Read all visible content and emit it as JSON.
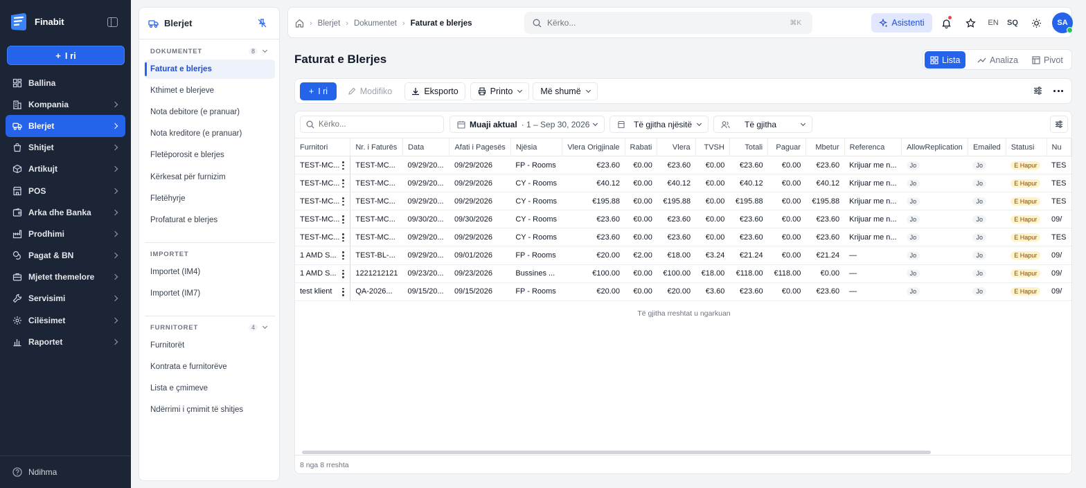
{
  "app": {
    "brand": "Finabit",
    "new_button": "I ri",
    "help": "Ndihma"
  },
  "sidebar": {
    "items": [
      {
        "label": "Ballina",
        "icon": "dashboard-icon",
        "chevron": false
      },
      {
        "label": "Kompania",
        "icon": "building-icon",
        "chevron": true
      },
      {
        "label": "Blerjet",
        "icon": "truck-icon",
        "chevron": true,
        "active": true
      },
      {
        "label": "Shitjet",
        "icon": "shopping-bag-icon",
        "chevron": true
      },
      {
        "label": "Artikujt",
        "icon": "box-icon",
        "chevron": true
      },
      {
        "label": "POS",
        "icon": "store-icon",
        "chevron": true
      },
      {
        "label": "Arka dhe Banka",
        "icon": "wallet-icon",
        "chevron": true
      },
      {
        "label": "Prodhimi",
        "icon": "factory-icon",
        "chevron": true
      },
      {
        "label": "Pagat & BN",
        "icon": "coins-icon",
        "chevron": true
      },
      {
        "label": "Mjetet themelore",
        "icon": "briefcase-icon",
        "chevron": true
      },
      {
        "label": "Servisimi",
        "icon": "wrench-icon",
        "chevron": true
      },
      {
        "label": "Cilësimet",
        "icon": "gear-icon",
        "chevron": true
      },
      {
        "label": "Raportet",
        "icon": "bar-chart-icon",
        "chevron": true
      }
    ]
  },
  "panel": {
    "title": "Blerjet",
    "sections": [
      {
        "title": "DOKUMENTET",
        "count": "8",
        "links": [
          "Faturat e blerjes",
          "Kthimet e blerjeve",
          "Nota debitore (e pranuar)",
          "Nota kreditore (e pranuar)",
          "Fletëporosit e blerjes",
          "Kërkesat për furnizim",
          "Fletëhyrje",
          "Profaturat e blerjes"
        ]
      },
      {
        "title": "IMPORTET",
        "count": "",
        "links": [
          "Importet (IM4)",
          "Importet (IM7)"
        ]
      },
      {
        "title": "FURNITORET",
        "count": "4",
        "links": [
          "Furnitorët",
          "Kontrata e furnitorëve",
          "Lista e çmimeve",
          "Ndërrimi i çmimit të shitjes"
        ]
      }
    ]
  },
  "topbar": {
    "breadcrumb": [
      "Blerjet",
      "Dokumentet",
      "Faturat e blerjes"
    ],
    "search_placeholder": "Kërko...",
    "shortcut": "⌘K",
    "assistant": "Asistenti",
    "lang_en": "EN",
    "lang_sq": "SQ",
    "avatar": "SA"
  },
  "page": {
    "title": "Faturat e Blerjes",
    "views": [
      "Lista",
      "Analiza",
      "Pivot"
    ]
  },
  "toolbar": {
    "new": "I ri",
    "edit": "Modifiko",
    "export": "Eksporto",
    "print": "Printo",
    "more": "Më shumë"
  },
  "filters": {
    "search_placeholder": "Kërko...",
    "period_label": "Muaji aktual",
    "period_range": "· 1 – Sep 30, 2026",
    "unit": "Të gjitha njësitë",
    "party": "Të gjitha"
  },
  "table": {
    "columns": [
      "Furnitori",
      "Nr. i Faturës",
      "Data",
      "Afati i Pagesës",
      "Njësia",
      "Vlera Origjinale",
      "Rabati",
      "Vlera",
      "TVSH",
      "Totali",
      "Paguar",
      "Mbetur",
      "Referenca",
      "AllowReplication",
      "Emailed",
      "Statusi",
      "Nu"
    ],
    "rows": [
      [
        "TEST-MC...",
        "TEST-MC...",
        "09/29/20...",
        "09/29/2026",
        "FP - Rooms",
        "€23.60",
        "€0.00",
        "€23.60",
        "€0.00",
        "€23.60",
        "€0.00",
        "€23.60",
        "Krijuar me n...",
        "Jo",
        "Jo",
        "E Hapur",
        "TES"
      ],
      [
        "TEST-MC...",
        "TEST-MC...",
        "09/29/20...",
        "09/29/2026",
        "CY - Rooms",
        "€40.12",
        "€0.00",
        "€40.12",
        "€0.00",
        "€40.12",
        "€0.00",
        "€40.12",
        "Krijuar me n...",
        "Jo",
        "Jo",
        "E Hapur",
        "TES"
      ],
      [
        "TEST-MC...",
        "TEST-MC...",
        "09/29/20...",
        "09/29/2026",
        "CY - Rooms",
        "€195.88",
        "€0.00",
        "€195.88",
        "€0.00",
        "€195.88",
        "€0.00",
        "€195.88",
        "Krijuar me n...",
        "Jo",
        "Jo",
        "E Hapur",
        "TES"
      ],
      [
        "TEST-MC...",
        "TEST-MC...",
        "09/30/20...",
        "09/30/2026",
        "CY - Rooms",
        "€23.60",
        "€0.00",
        "€23.60",
        "€0.00",
        "€23.60",
        "€0.00",
        "€23.60",
        "Krijuar me n...",
        "Jo",
        "Jo",
        "E Hapur",
        "09/"
      ],
      [
        "TEST-MC...",
        "TEST-MC...",
        "09/29/20...",
        "09/29/2026",
        "CY - Rooms",
        "€23.60",
        "€0.00",
        "€23.60",
        "€0.00",
        "€23.60",
        "€0.00",
        "€23.60",
        "Krijuar me n...",
        "Jo",
        "Jo",
        "E Hapur",
        "TES"
      ],
      [
        "1 AMD S...",
        "TEST-BL-...",
        "09/29/20...",
        "09/01/2026",
        "FP - Rooms",
        "€20.00",
        "€2.00",
        "€18.00",
        "€3.24",
        "€21.24",
        "€0.00",
        "€21.24",
        "—",
        "Jo",
        "Jo",
        "E Hapur",
        "09/"
      ],
      [
        "1 AMD S...",
        "1221212121",
        "09/23/20...",
        "09/23/2026",
        "Bussines ...",
        "€100.00",
        "€0.00",
        "€100.00",
        "€18.00",
        "€118.00",
        "€118.00",
        "€0.00",
        "—",
        "Jo",
        "Jo",
        "E Hapur",
        "09/"
      ],
      [
        "test klient",
        "QA-2026...",
        "09/15/20...",
        "09/15/2026",
        "FP - Rooms",
        "€20.00",
        "€0.00",
        "€20.00",
        "€3.60",
        "€23.60",
        "€0.00",
        "€23.60",
        "—",
        "Jo",
        "Jo",
        "E Hapur",
        "09/"
      ]
    ],
    "loaded_text": "Të gjitha rreshtat u ngarkuan",
    "footer": "8 nga 8 rreshta"
  },
  "colors": {
    "primary": "#2563eb",
    "sidebar_bg": "#1b2536",
    "status_open_bg": "#fef3c7"
  }
}
